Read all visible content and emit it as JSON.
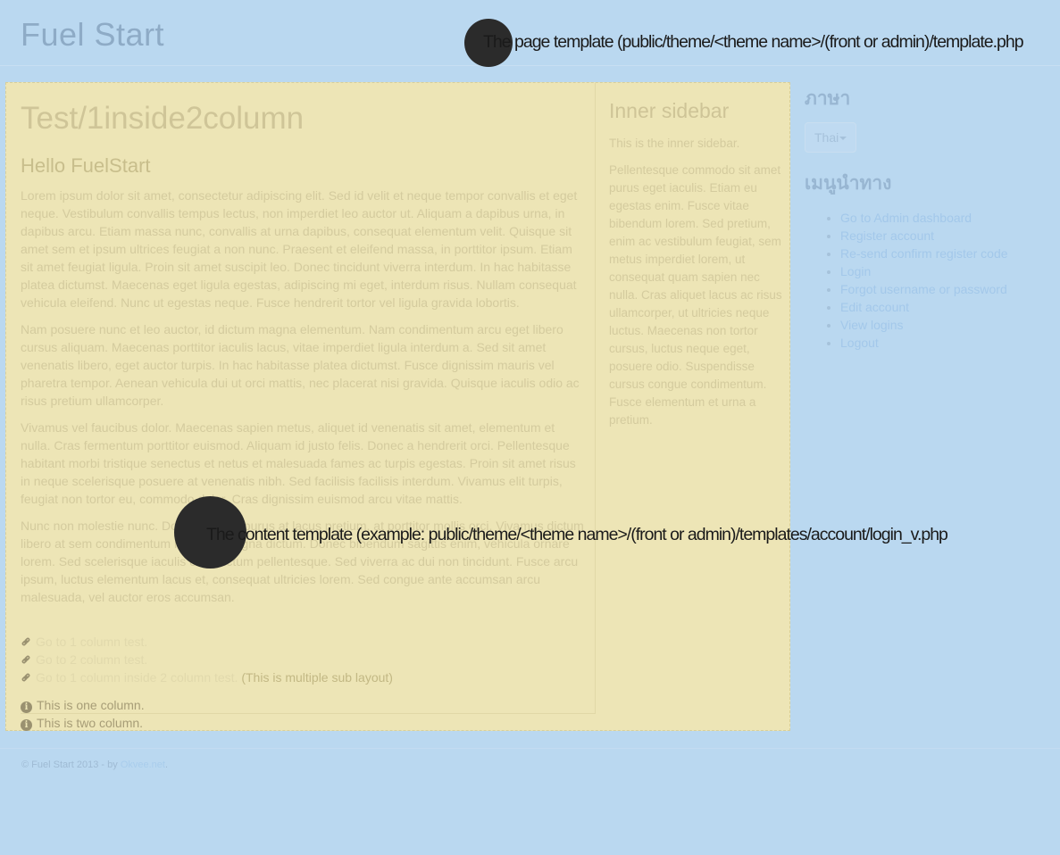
{
  "header": {
    "site_title": "Fuel Start"
  },
  "annotations": {
    "page_template": "The page template (public/theme/<theme name>/(front or admin)/template.php",
    "content_template": "The content template (example: public/theme/<theme name>/(front or admin)/templates/account/login_v.php"
  },
  "main": {
    "page_title": "Test/1inside2column",
    "heading": "Hello FuelStart",
    "paragraphs": [
      "Lorem ipsum dolor sit amet, consectetur adipiscing elit. Sed id velit et neque tempor convallis et eget neque. Vestibulum convallis tempus lectus, non imperdiet leo auctor ut. Aliquam a dapibus urna, in dapibus arcu. Etiam massa nunc, convallis at urna dapibus, consequat elementum velit. Quisque sit amet sem et ipsum ultrices feugiat a non nunc. Praesent et eleifend massa, in porttitor ipsum. Etiam sit amet feugiat ligula. Proin sit amet suscipit leo. Donec tincidunt viverra interdum. In hac habitasse platea dictumst. Maecenas eget ligula egestas, adipiscing mi eget, interdum risus. Nullam consequat vehicula eleifend. Nunc ut egestas neque. Fusce hendrerit tortor vel ligula gravida lobortis.",
      "Nam posuere nunc et leo auctor, id dictum magna elementum. Nam condimentum arcu eget libero cursus aliquam. Maecenas porttitor iaculis lacus, vitae imperdiet ligula interdum a. Sed sit amet venenatis libero, eget auctor turpis. In hac habitasse platea dictumst. Fusce dignissim mauris vel pharetra tempor. Aenean vehicula dui ut orci mattis, nec placerat nisi gravida. Quisque iaculis odio ac risus pretium ullamcorper.",
      "Vivamus vel faucibus dolor. Maecenas sapien metus, aliquet id venenatis sit amet, elementum et nulla. Cras fermentum porttitor euismod. Aliquam id justo felis. Donec a hendrerit orci. Pellentesque habitant morbi tristique senectus et netus et malesuada fames ac turpis egestas. Proin sit amet risus in neque scelerisque posuere at venenatis nibh. Sed facilisis facilisis interdum. Vivamus elit turpis, feugiat non tortor eu, commodo dolor. Cras dignissim euismod arcu vitae mattis.",
      "Nunc non molestie nunc. Donec tempor purus at lacus pretium, at porttitor mollis orci. Vivamus dictum libero at sem condimentum molestie magna dictum. Donec bibendum sagittis enim, vehicula ornare lorem. Sed scelerisque iaculis odio dictum pellentesque. Sed viverra ac dui non tincidunt. Fusce arcu ipsum, luctus elementum lacus et, consequat ultricies lorem. Sed congue ante accumsan arcu malesuada, vel auctor eros accumsan."
    ],
    "links": [
      {
        "label": "Go to 1 column test.",
        "tail": ""
      },
      {
        "label": "Go to 2 column test.",
        "tail": ""
      },
      {
        "label": "Go to 1 column inside 2 column test.",
        "tail": " (This is multiple sub layout)"
      }
    ],
    "infos": [
      "This is one column.",
      "This is two column."
    ]
  },
  "inner_sidebar": {
    "title": "Inner sidebar",
    "intro": "This is the inner sidebar.",
    "body": "Pellentesque commodo sit amet purus eget iaculis. Etiam eu egestas enim. Fusce vitae bibendum lorem. Sed pretium, enim ac vestibulum feugiat, sem metus imperdiet lorem, ut consequat quam sapien nec nulla. Cras aliquet lacus ac risus ullamcorper, ut ultricies neque luctus. Maecenas non tortor cursus, luctus neque eget, posuere odio. Suspendisse cursus congue condimentum. Fusce elementum et urna a pretium."
  },
  "right_sidebar": {
    "language_title": "ภาษา",
    "language_selected": "Thai",
    "menu_title": "เมนูนำทาง",
    "menu_items": [
      "Go to Admin dashboard",
      "Register account",
      "Re-send confirm register code",
      "Login",
      "Forgot username or password",
      "Edit account",
      "View logins",
      "Logout"
    ]
  },
  "footer": {
    "text": "© Fuel Start 2013 - by ",
    "link": "Okvee.net",
    "suffix": "."
  }
}
